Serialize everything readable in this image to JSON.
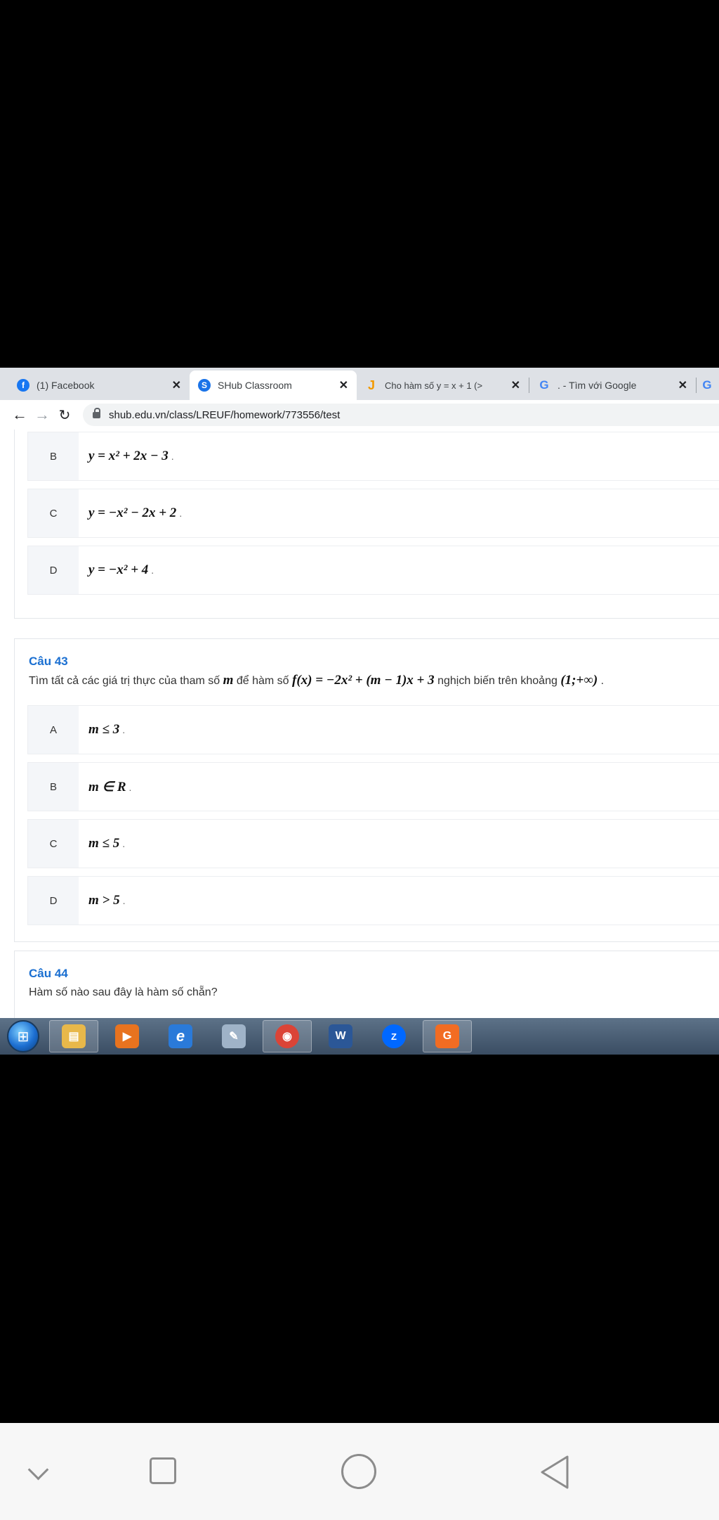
{
  "browser": {
    "tabs": [
      {
        "title": "(1) Facebook",
        "icon": "facebook-icon",
        "color": "#1877f2",
        "glyph": "f",
        "active": false
      },
      {
        "title": "SHub Classroom",
        "icon": "shub-icon",
        "color": "#1a73e8",
        "glyph": "S",
        "active": true
      },
      {
        "title": "Cho hàm số y = x + 1 (>",
        "icon": "j-icon",
        "color": "#f29900",
        "glyph": "J",
        "active": false
      },
      {
        "title": ". - Tìm với Google",
        "icon": "google-icon",
        "color": "#4285f4",
        "glyph": "G",
        "active": false
      }
    ],
    "url": "shub.edu.vn/class/LREUF/homework/773556/test"
  },
  "questions": {
    "prev_options": [
      {
        "letter": "B",
        "text": "y = x² + 2x − 3"
      },
      {
        "letter": "C",
        "text": "y = −x² − 2x + 2"
      },
      {
        "letter": "D",
        "text": "y = −x² + 4"
      }
    ],
    "q43": {
      "label": "Câu 43",
      "text_part1": "Tìm tất cả các giá trị thực của tham số",
      "math_m": "m",
      "text_part2": "để hàm số",
      "math_f": "f(x) = −2x² + (m − 1)x + 3",
      "text_part3": "nghịch biến trên khoảng",
      "math_interval": "(1;+∞)",
      "options": [
        {
          "letter": "A",
          "text": "m ≤ 3"
        },
        {
          "letter": "B",
          "text": "m ∈ R"
        },
        {
          "letter": "C",
          "text": "m ≤ 5"
        },
        {
          "letter": "D",
          "text": "m > 5"
        }
      ]
    },
    "q44": {
      "label": "Câu 44",
      "text": "Hàm số nào sau đây là hàm số chẵn?"
    }
  },
  "taskbar": {
    "items": [
      {
        "name": "file-explorer-icon",
        "color": "#e8b84a",
        "glyph": "▤",
        "highlight": true
      },
      {
        "name": "media-player-icon",
        "color": "#e8731f",
        "glyph": "▶",
        "highlight": false
      },
      {
        "name": "internet-explorer-icon",
        "color": "#2a7ad9",
        "glyph": "e",
        "highlight": false
      },
      {
        "name": "paint-icon",
        "color": "#9fb3c8",
        "glyph": "✎",
        "highlight": false
      },
      {
        "name": "chrome-icon",
        "color": "#db4437",
        "glyph": "◉",
        "highlight": true
      },
      {
        "name": "word-icon",
        "color": "#2b5797",
        "glyph": "W",
        "highlight": false
      },
      {
        "name": "zalo-icon",
        "color": "#0068ff",
        "glyph": "Z",
        "highlight": false
      },
      {
        "name": "garena-icon",
        "color": "#f26c22",
        "glyph": "G",
        "highlight": true
      }
    ]
  }
}
